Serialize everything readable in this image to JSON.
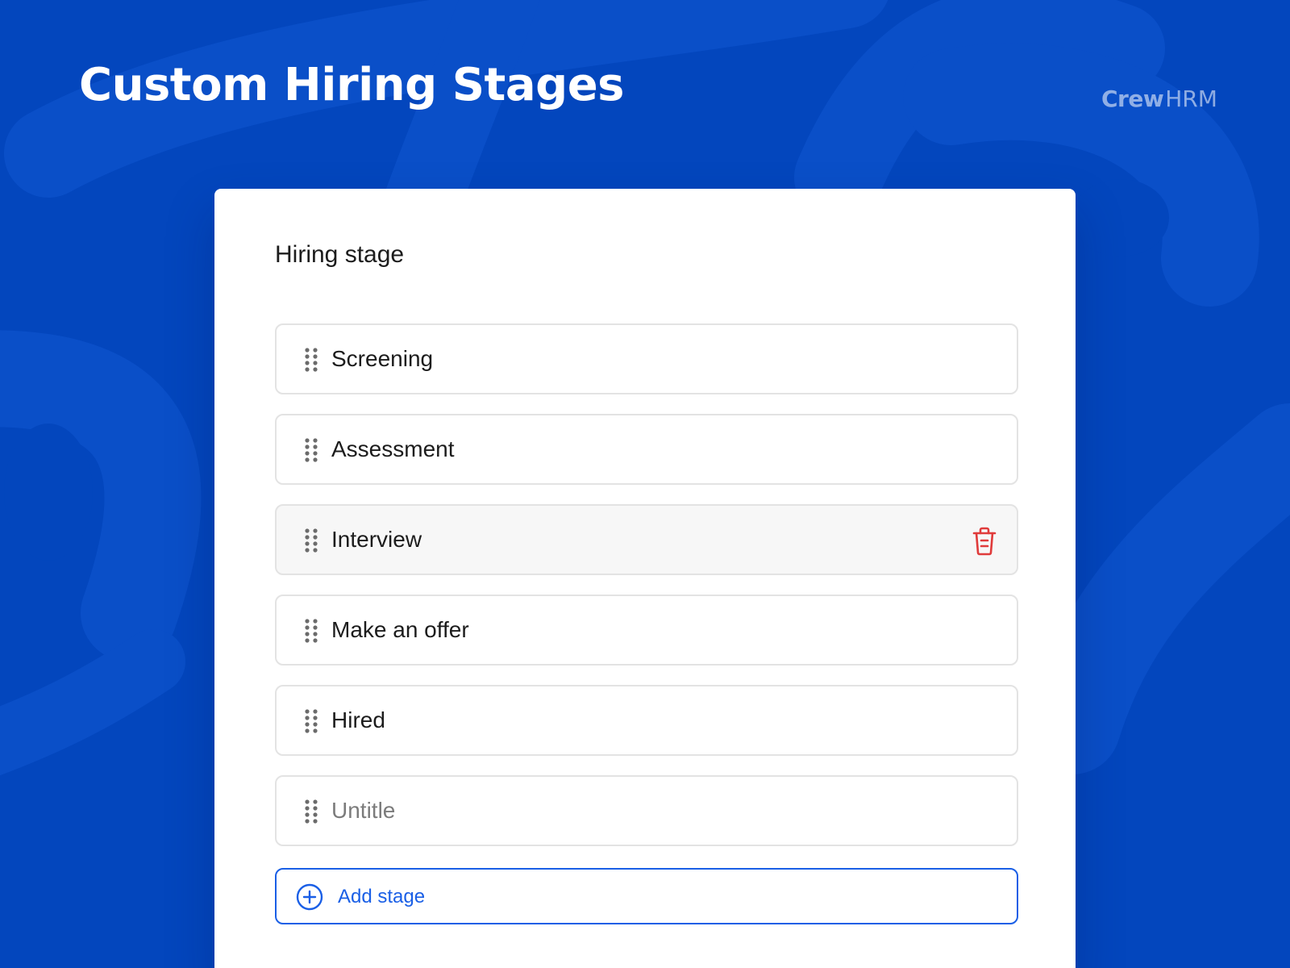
{
  "page": {
    "title": "Custom Hiring Stages",
    "brand": {
      "name": "Crew",
      "suffix": "HRM"
    }
  },
  "colors": {
    "background": "#0346bd",
    "card": "#ffffff",
    "accent": "#1a5fe6",
    "danger": "#e03b3b",
    "border": "#e3e3e3"
  },
  "panel": {
    "title": "Hiring stage",
    "stages": [
      {
        "label": "Screening",
        "placeholder": false,
        "hovered": false
      },
      {
        "label": "Assessment",
        "placeholder": false,
        "hovered": false
      },
      {
        "label": "Interview",
        "placeholder": false,
        "hovered": true,
        "icon": "trash-icon"
      },
      {
        "label": "Make an offer",
        "placeholder": false,
        "hovered": false
      },
      {
        "label": "Hired",
        "placeholder": false,
        "hovered": false
      },
      {
        "label": "Untitle",
        "placeholder": true,
        "hovered": false
      }
    ],
    "add_button": {
      "label": "Add stage",
      "icon": "plus-circle-icon"
    }
  }
}
